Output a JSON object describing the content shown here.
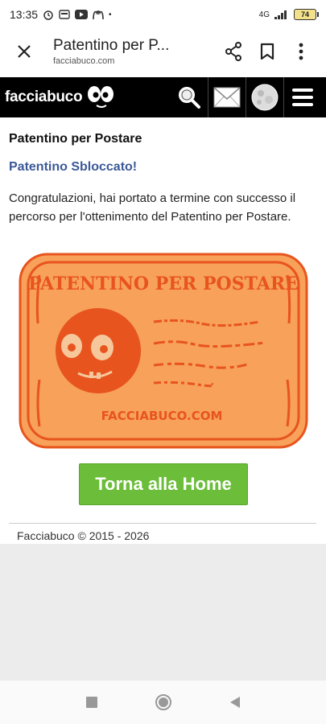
{
  "status": {
    "time": "13:35",
    "network": "4G",
    "battery": "74"
  },
  "app_bar": {
    "title": "Patentino per P...",
    "url": "facciabuco.com"
  },
  "site": {
    "logo_text": "facciabuco"
  },
  "content": {
    "heading": "Patentino per Postare",
    "subheading": "Patentino Sbloccato!",
    "message": "Congratulazioni, hai portato a termine con successo il percorso per l'ottenimento del Patentino per Postare."
  },
  "card": {
    "title": "PATENTINO PER POSTARE",
    "domain": "FACCIABUCO.COM"
  },
  "button": {
    "label": "Torna alla Home"
  },
  "footer": {
    "text": "Facciabuco © 2015 - 2026"
  },
  "colors": {
    "header_bg": "#000000",
    "link_blue": "#3b5998",
    "button_green": "#6bbd3a",
    "card_orange": "#f7a15a",
    "card_stroke": "#e8541e"
  }
}
